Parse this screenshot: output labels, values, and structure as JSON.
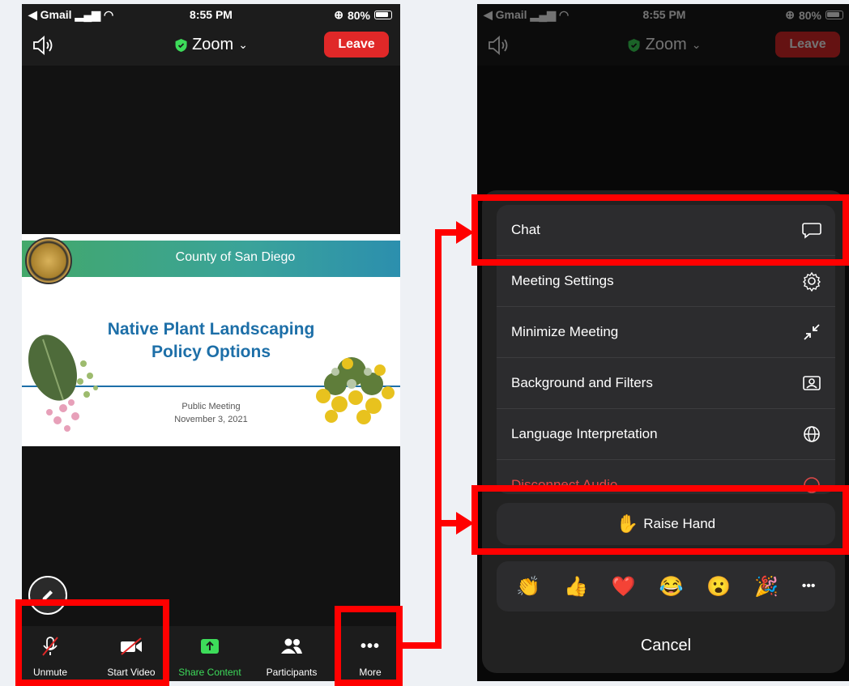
{
  "status_bar": {
    "back_label": "◀ Gmail",
    "time": "8:55 PM",
    "battery": "80%"
  },
  "meeting_bar": {
    "title": "Zoom",
    "leave_label": "Leave"
  },
  "slide": {
    "header": "County of San Diego",
    "title_line1": "Native Plant Landscaping",
    "title_line2": "Policy Options",
    "subtitle_line1": "Public Meeting",
    "subtitle_line2": "November 3, 2021"
  },
  "toolbar": {
    "items": [
      {
        "label": "Unmute",
        "icon": "muted-mic-icon"
      },
      {
        "label": "Start Video",
        "icon": "video-off-icon"
      },
      {
        "label": "Share Content",
        "icon": "share-icon"
      },
      {
        "label": "Participants",
        "icon": "participants-icon"
      },
      {
        "label": "More",
        "icon": "more-icon"
      }
    ]
  },
  "more_menu": {
    "items": [
      {
        "label": "Chat",
        "icon": "chat-icon"
      },
      {
        "label": "Meeting Settings",
        "icon": "gear-icon"
      },
      {
        "label": "Minimize Meeting",
        "icon": "minimize-icon"
      },
      {
        "label": "Background and Filters",
        "icon": "background-icon"
      },
      {
        "label": "Language Interpretation",
        "icon": "globe-icon"
      },
      {
        "label": "Disconnect Audio",
        "icon": "disconnect-icon"
      }
    ],
    "raise_hand_label": "Raise Hand",
    "reactions": [
      "👏",
      "👍",
      "❤️",
      "😂",
      "😮",
      "🎉",
      "•••"
    ],
    "cancel_label": "Cancel"
  },
  "colors": {
    "highlight": "#ff0000",
    "leave": "#e02828",
    "share": "#3ddc5a",
    "shield": "#3ddc5a"
  }
}
